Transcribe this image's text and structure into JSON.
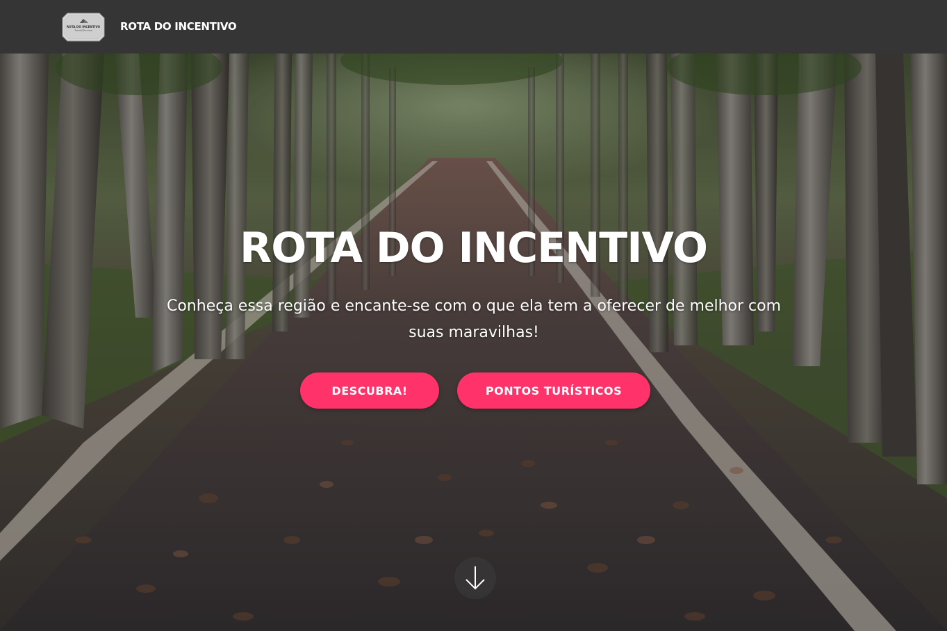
{
  "navbar": {
    "logo_text_line1": "ROTA DO INCENTIVO",
    "logo_text_line2": "Travel&Tourism",
    "brand": "ROTA DO INCENTIVO"
  },
  "hero": {
    "title": "ROTA DO INCENTIVO",
    "subtitle": "Conheça essa região e encante-se com o que ela tem a oferecer de melhor com suas maravilhas!",
    "buttons": {
      "discover": "DESCUBRA!",
      "points": "PONTOS TURÍSTICOS"
    },
    "scroll_icon": "arrow-down-icon",
    "background": "tree-lined-road-photo"
  },
  "colors": {
    "navbar_bg": "#353535",
    "accent": "#ff3269",
    "text": "#ffffff"
  }
}
